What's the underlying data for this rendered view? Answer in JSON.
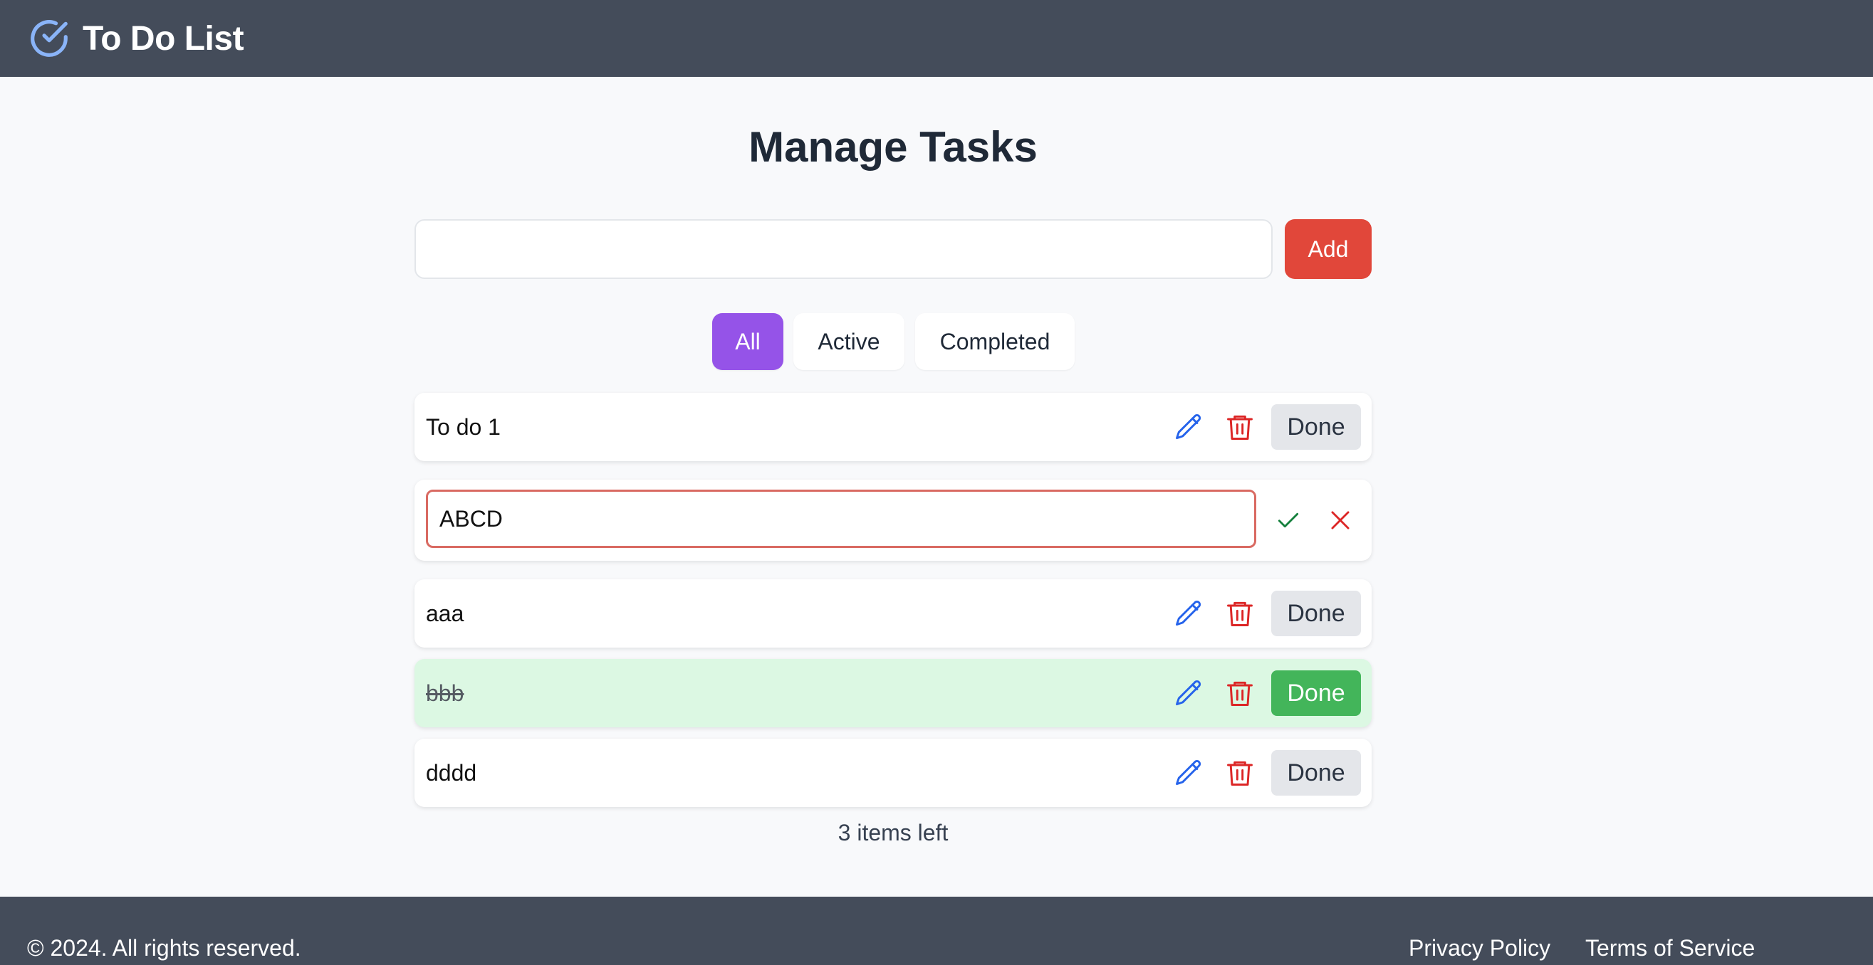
{
  "header": {
    "title": "To Do List",
    "logo_icon": "check-circle-icon"
  },
  "main": {
    "title": "Manage Tasks",
    "new_task": {
      "value": "",
      "placeholder": ""
    },
    "add_label": "Add",
    "filters": [
      {
        "label": "All",
        "active": true
      },
      {
        "label": "Active",
        "active": false
      },
      {
        "label": "Completed",
        "active": false
      }
    ],
    "tasks": [
      {
        "text": "To do 1",
        "completed": false,
        "editing": false,
        "done_label": "Done"
      },
      {
        "text": "ABCD",
        "completed": false,
        "editing": true
      },
      {
        "text": "aaa",
        "completed": false,
        "editing": false,
        "done_label": "Done"
      },
      {
        "text": "bbb",
        "completed": true,
        "editing": false,
        "done_label": "Done"
      },
      {
        "text": "dddd",
        "completed": false,
        "editing": false,
        "done_label": "Done"
      }
    ],
    "items_left": "3 items left"
  },
  "footer": {
    "copyright": "© 2024. All rights reserved.",
    "links": [
      "Privacy Policy",
      "Terms of Service"
    ]
  },
  "colors": {
    "header_bg": "#444c5a",
    "add_button": "#e1473a",
    "filter_active": "#9553e8",
    "done_completed": "#43b55a",
    "completed_row_bg": "#dcf8e3",
    "edit_icon": "#2563eb",
    "delete_icon": "#dc2626"
  }
}
